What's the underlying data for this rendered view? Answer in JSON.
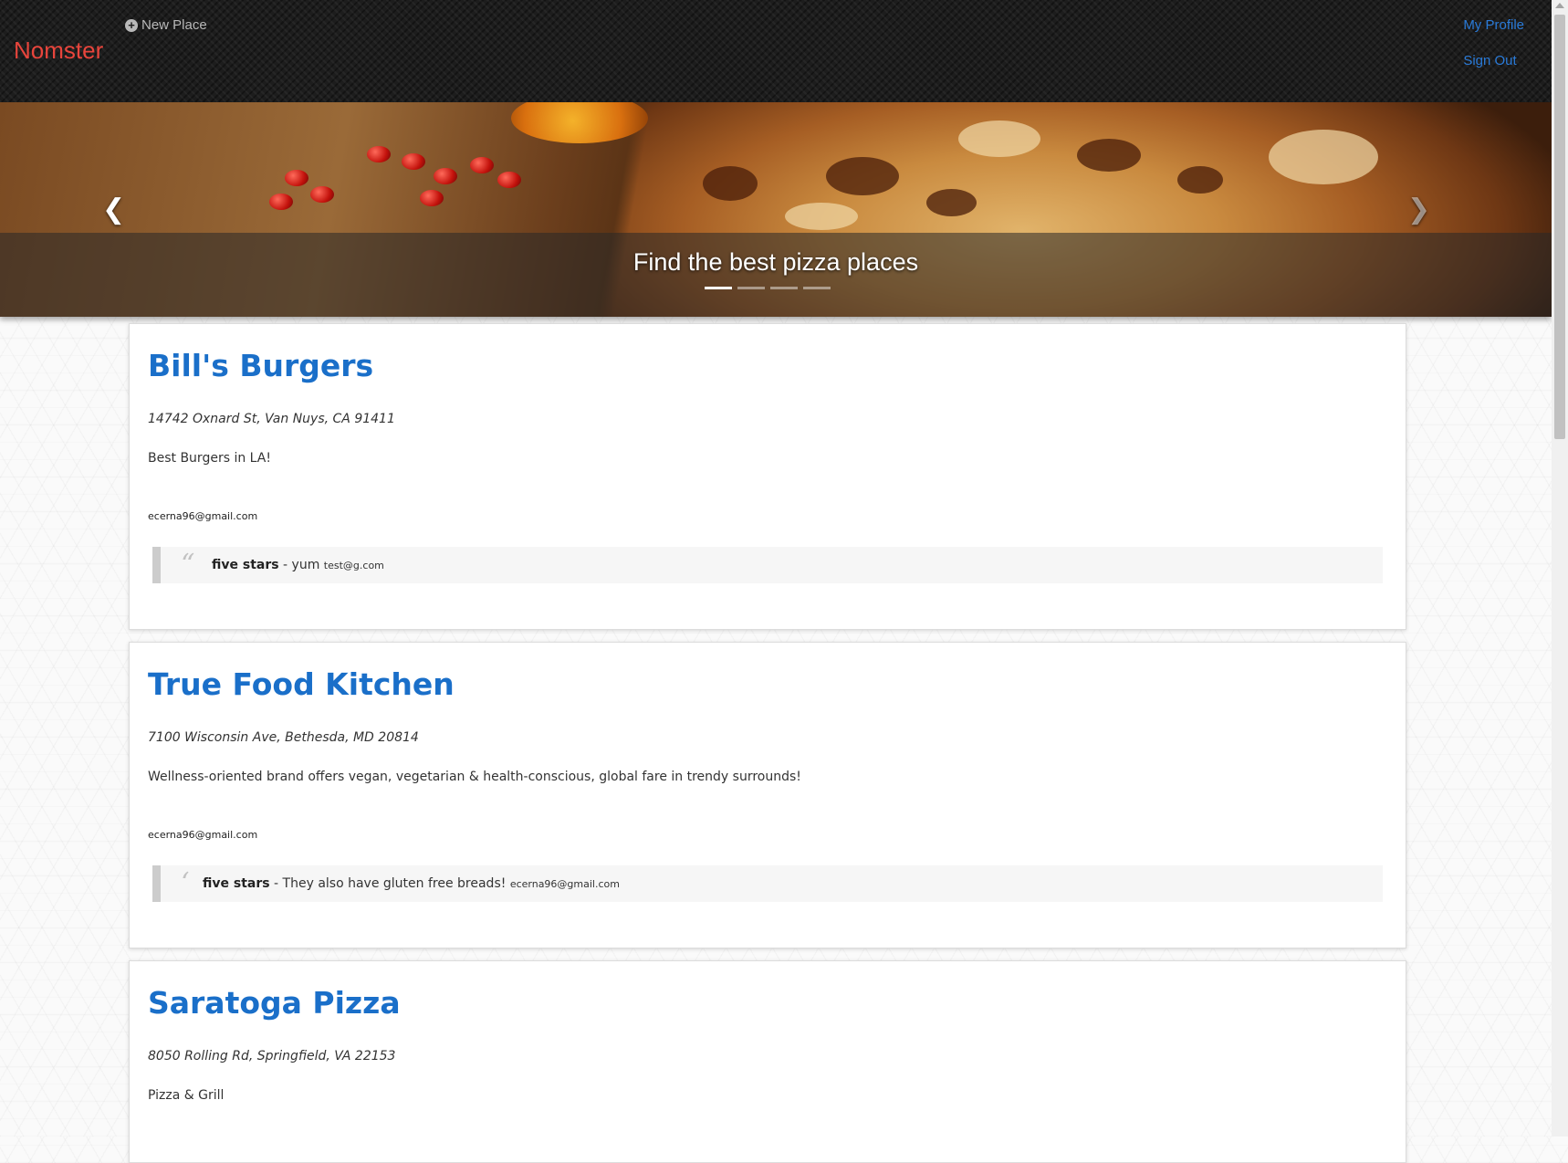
{
  "navbar": {
    "brand": "Nomster",
    "new_place_label": "New Place",
    "my_profile_label": "My Profile",
    "sign_out_label": "Sign Out",
    "brand_color": "#e8453c",
    "link_color": "#2a7bd9"
  },
  "carousel": {
    "caption": "Find the best pizza places",
    "slide_count": 4,
    "active_slide": 1,
    "prev_icon": "chevron-left-icon",
    "next_icon": "chevron-right-icon"
  },
  "places": [
    {
      "name": "Bill's Burgers",
      "address": "14742 Oxnard St, Van Nuys, CA 91411",
      "description": "Best Burgers in LA!",
      "owner": "ecerna96@gmail.com",
      "comment": {
        "rating": "five stars",
        "text": " - yum ",
        "user": "test@g.com"
      }
    },
    {
      "name": "True Food Kitchen",
      "address": "7100 Wisconsin Ave, Bethesda, MD 20814",
      "description": "Wellness-oriented brand offers vegan, vegetarian & health-conscious, global fare in trendy surrounds!",
      "owner": "ecerna96@gmail.com",
      "comment": {
        "rating": "five stars",
        "text": " - They also have gluten free breads! ",
        "user": "ecerna96@gmail.com"
      }
    },
    {
      "name": "Saratoga Pizza",
      "address": "8050 Rolling Rd, Springfield, VA 22153",
      "description": "Pizza & Grill"
    }
  ]
}
